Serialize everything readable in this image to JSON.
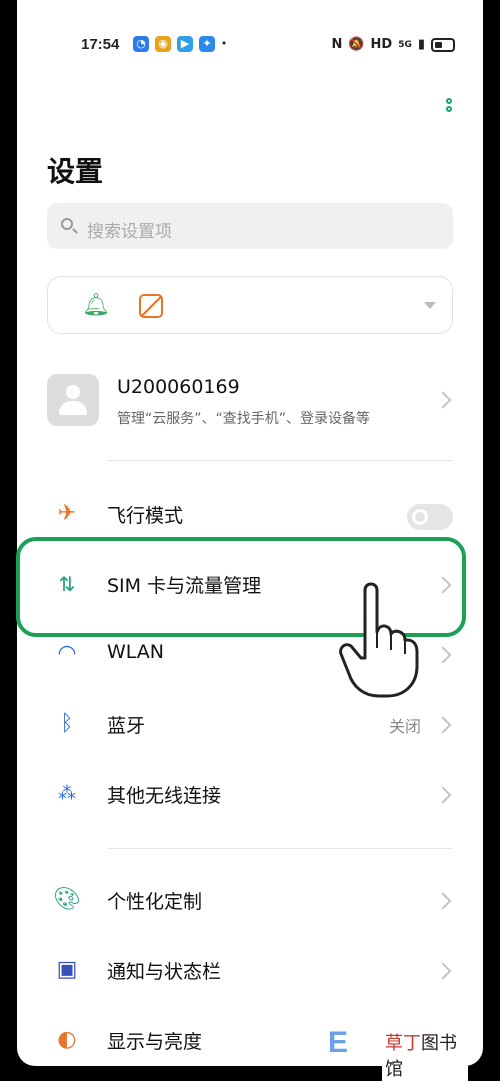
{
  "status_bar": {
    "time": "17:54",
    "network": "HD",
    "signal_label": "5G"
  },
  "header": {
    "more_icon": "more-dots-icon",
    "title": "设置"
  },
  "search": {
    "placeholder": "搜索设置项"
  },
  "quick_panel": {
    "icons": [
      "bell-icon",
      "wallpaper-icon"
    ]
  },
  "account": {
    "name": "U200060169",
    "subtitle": "管理“云服务”、“查找手机”、登录设备等"
  },
  "settings": [
    {
      "label": "飞行模式",
      "icon": "airplane-icon",
      "control": "toggle",
      "on": false
    },
    {
      "label": "SIM 卡与流量管理",
      "icon": "sim-data-icon",
      "highlighted": true
    },
    {
      "label": "WLAN",
      "icon": "wifi-icon"
    },
    {
      "label": "蓝牙",
      "icon": "bluetooth-icon",
      "value": "关闭"
    },
    {
      "label": "其他无线连接",
      "icon": "wireless-icon"
    },
    {
      "label": "个性化定制",
      "icon": "palette-icon"
    },
    {
      "label": "通知与状态栏",
      "icon": "notification-icon"
    },
    {
      "label": "显示与亮度",
      "icon": "display-icon"
    }
  ],
  "colors": {
    "accent": "#1ba055",
    "highlight_border": "#1ba055",
    "airplane": "#e8742b",
    "bluetooth": "#2f6fd6"
  },
  "watermark": {
    "brand": "草丁图书馆",
    "brand_red": "草丁",
    "brand_black": "图书馆"
  }
}
